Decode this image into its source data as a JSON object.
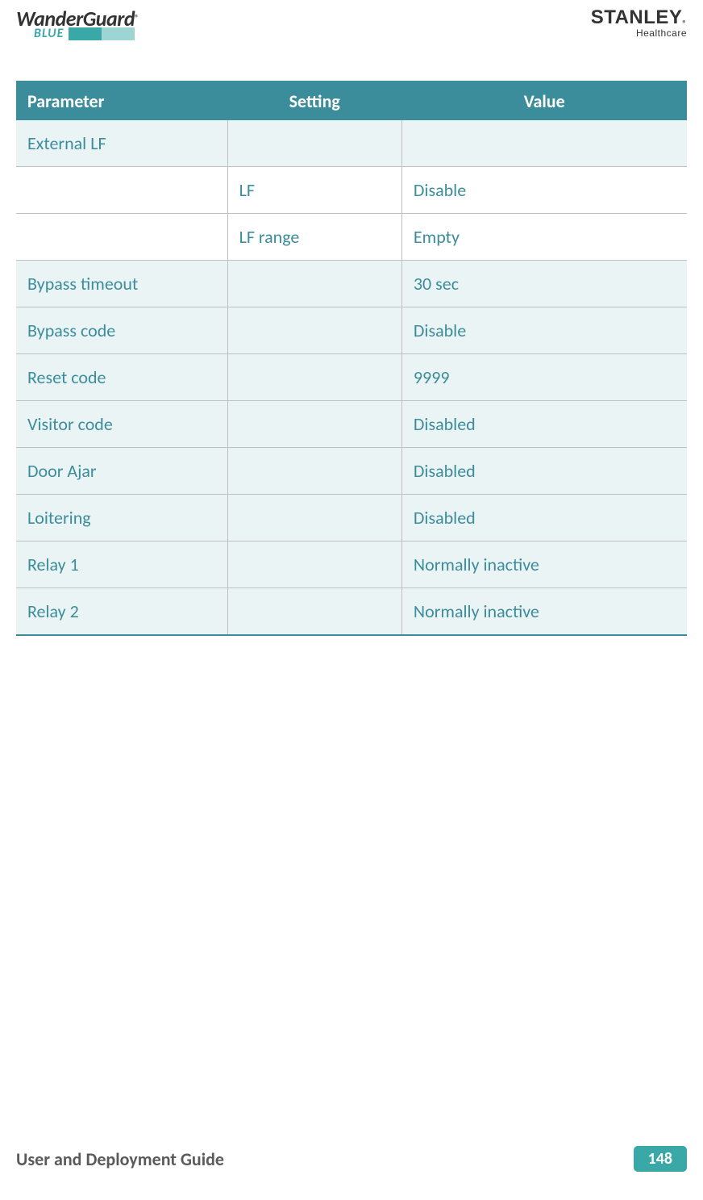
{
  "header": {
    "logo_left_line1": "WanderGuard",
    "logo_left_reg": "®",
    "logo_left_line2": "BLUE",
    "logo_right_line1": "STANLEY",
    "logo_right_sub": "®",
    "logo_right_line2": "Healthcare"
  },
  "table": {
    "headers": [
      "Parameter",
      "Setting",
      "Value"
    ],
    "rows": [
      {
        "parameter": "External LF",
        "setting": "",
        "value": "",
        "shaded": true
      },
      {
        "parameter": "",
        "setting": "LF",
        "value": "Disable",
        "shaded": false
      },
      {
        "parameter": "",
        "setting": "LF range",
        "value": "Empty",
        "shaded": false
      },
      {
        "parameter": "Bypass timeout",
        "setting": "",
        "value": "30 sec",
        "shaded": true
      },
      {
        "parameter": "Bypass code",
        "setting": "",
        "value": "Disable",
        "shaded": true
      },
      {
        "parameter": "Reset code",
        "setting": "",
        "value": "9999",
        "shaded": true
      },
      {
        "parameter": "Visitor code",
        "setting": "",
        "value": "Disabled",
        "shaded": true
      },
      {
        "parameter": "Door Ajar",
        "setting": "",
        "value": "Disabled",
        "shaded": true
      },
      {
        "parameter": "Loitering",
        "setting": "",
        "value": "Disabled",
        "shaded": true
      },
      {
        "parameter": "Relay 1",
        "setting": "",
        "value": "Normally inactive",
        "shaded": true
      },
      {
        "parameter": "Relay 2",
        "setting": "",
        "value": "Normally inactive",
        "shaded": true
      }
    ]
  },
  "footer": {
    "title": "User and Deployment Guide",
    "page": "148"
  }
}
